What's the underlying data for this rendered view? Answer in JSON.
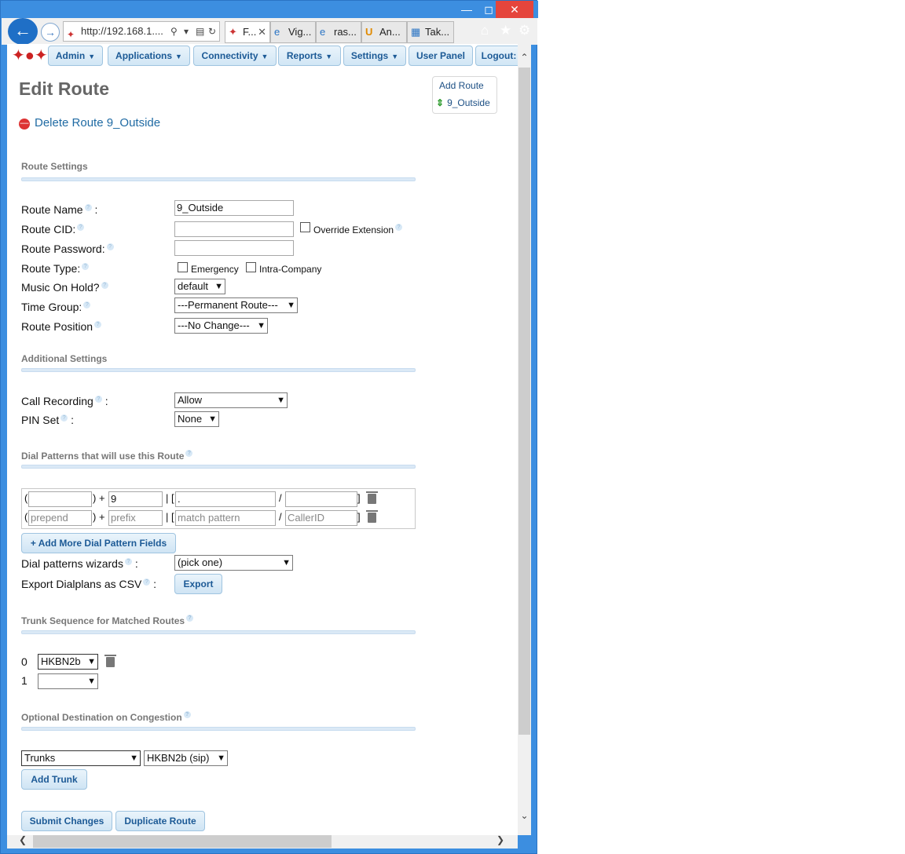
{
  "browser": {
    "address": "http://192.168.1....",
    "tabs": [
      {
        "label": "F...",
        "active": true
      },
      {
        "label": "Vig..."
      },
      {
        "label": "ras..."
      },
      {
        "label": "An..."
      },
      {
        "label": "Tak..."
      }
    ]
  },
  "menu": {
    "items": [
      "Admin",
      "Applications",
      "Connectivity",
      "Reports",
      "Settings",
      "User Panel",
      "Logout:"
    ]
  },
  "rightnav": {
    "add": "Add Route",
    "current": "9_Outside"
  },
  "page": {
    "title": "Edit Route",
    "delete_link": "Delete Route 9_Outside"
  },
  "route_settings": {
    "heading": "Route Settings",
    "route_name_label": "Route Name",
    "route_name_value": "9_Outside",
    "route_cid_label": "Route CID:",
    "override_label": "Override Extension",
    "route_password_label": "Route Password:",
    "route_type_label": "Route Type:",
    "emergency_label": "Emergency",
    "intra_label": "Intra-Company",
    "moh_label": "Music On Hold?",
    "moh_value": "default",
    "time_group_label": "Time Group:",
    "time_group_value": "---Permanent Route---",
    "route_position_label": "Route Position",
    "route_position_value": "---No Change---"
  },
  "additional": {
    "heading": "Additional Settings",
    "call_recording_label": "Call Recording",
    "call_recording_value": "Allow",
    "pin_set_label": "PIN Set",
    "pin_set_value": "None"
  },
  "dial_patterns": {
    "heading": "Dial Patterns that will use this Route",
    "rows": [
      {
        "prepend": "",
        "prefix": "9",
        "match": ".",
        "callerid": ""
      },
      {
        "prepend": "prepend",
        "prefix": "prefix",
        "match": "match pattern",
        "callerid": "CallerID"
      }
    ],
    "add_more": "+ Add More Dial Pattern Fields",
    "wizard_label": "Dial patterns wizards",
    "wizard_value": "(pick one)",
    "export_label": "Export Dialplans as CSV",
    "export_button": "Export"
  },
  "trunks": {
    "heading": "Trunk Sequence for Matched Routes",
    "rows": [
      {
        "index": "0",
        "value": "HKBN2b"
      },
      {
        "index": "1",
        "value": ""
      }
    ]
  },
  "congestion": {
    "heading": "Optional Destination on Congestion",
    "type_value": "Trunks",
    "dest_value": "HKBN2b (sip)",
    "add_trunk": "Add Trunk"
  },
  "footer": {
    "submit": "Submit Changes",
    "duplicate": "Duplicate Route"
  }
}
